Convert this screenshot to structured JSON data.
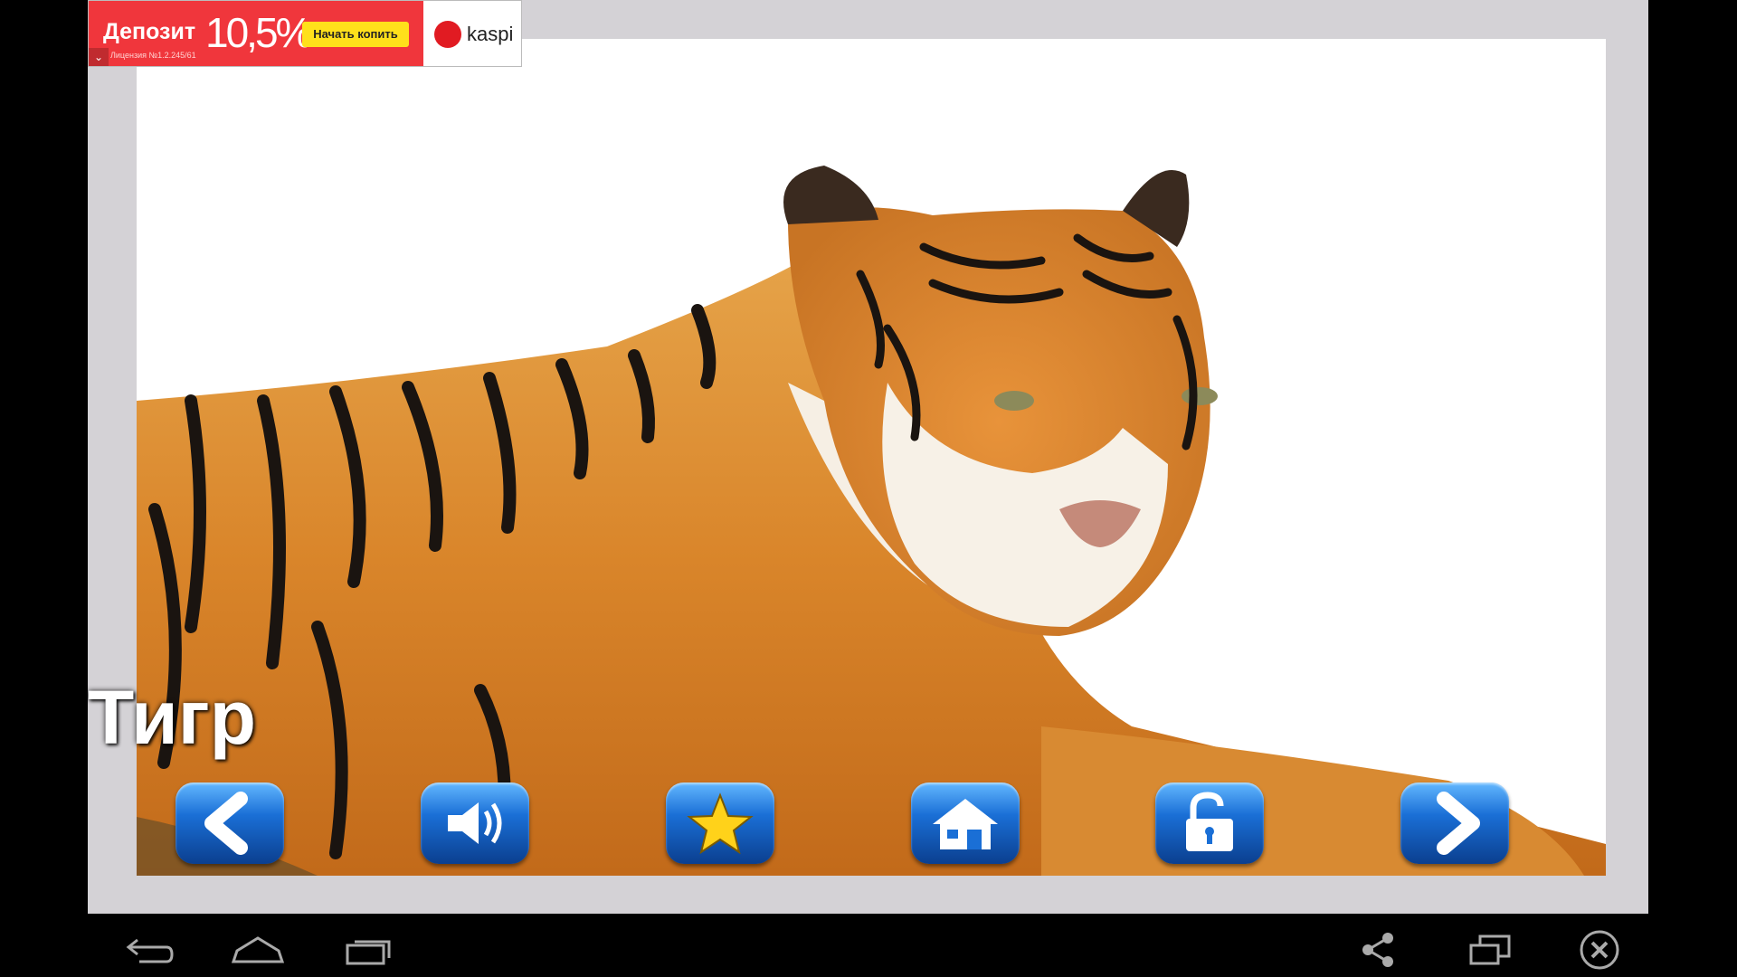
{
  "ad": {
    "title": "Депозит",
    "rate": "10,5%",
    "cta_label": "Начать копить",
    "license_text": "Лицензия №1.2.245/61",
    "brand": "kaspi"
  },
  "content": {
    "animal_name": "Тигр"
  },
  "colors": {
    "ad_red": "#f0363c",
    "cta_yellow": "#ffe01b",
    "button_blue": "#1a6fd6",
    "frame_gray": "#d4d2d6"
  },
  "toolbar": {
    "buttons": [
      {
        "name": "previous",
        "icon": "chevron-left-icon"
      },
      {
        "name": "sound",
        "icon": "speaker-icon"
      },
      {
        "name": "favorite",
        "icon": "star-icon"
      },
      {
        "name": "home",
        "icon": "home-icon"
      },
      {
        "name": "unlock",
        "icon": "unlock-icon"
      },
      {
        "name": "next",
        "icon": "chevron-right-icon"
      }
    ]
  },
  "system_nav": {
    "left": [
      "back-icon",
      "home-outline-icon",
      "recent-apps-icon"
    ],
    "right": [
      "share-icon",
      "window-resize-icon",
      "close-circle-icon"
    ]
  }
}
